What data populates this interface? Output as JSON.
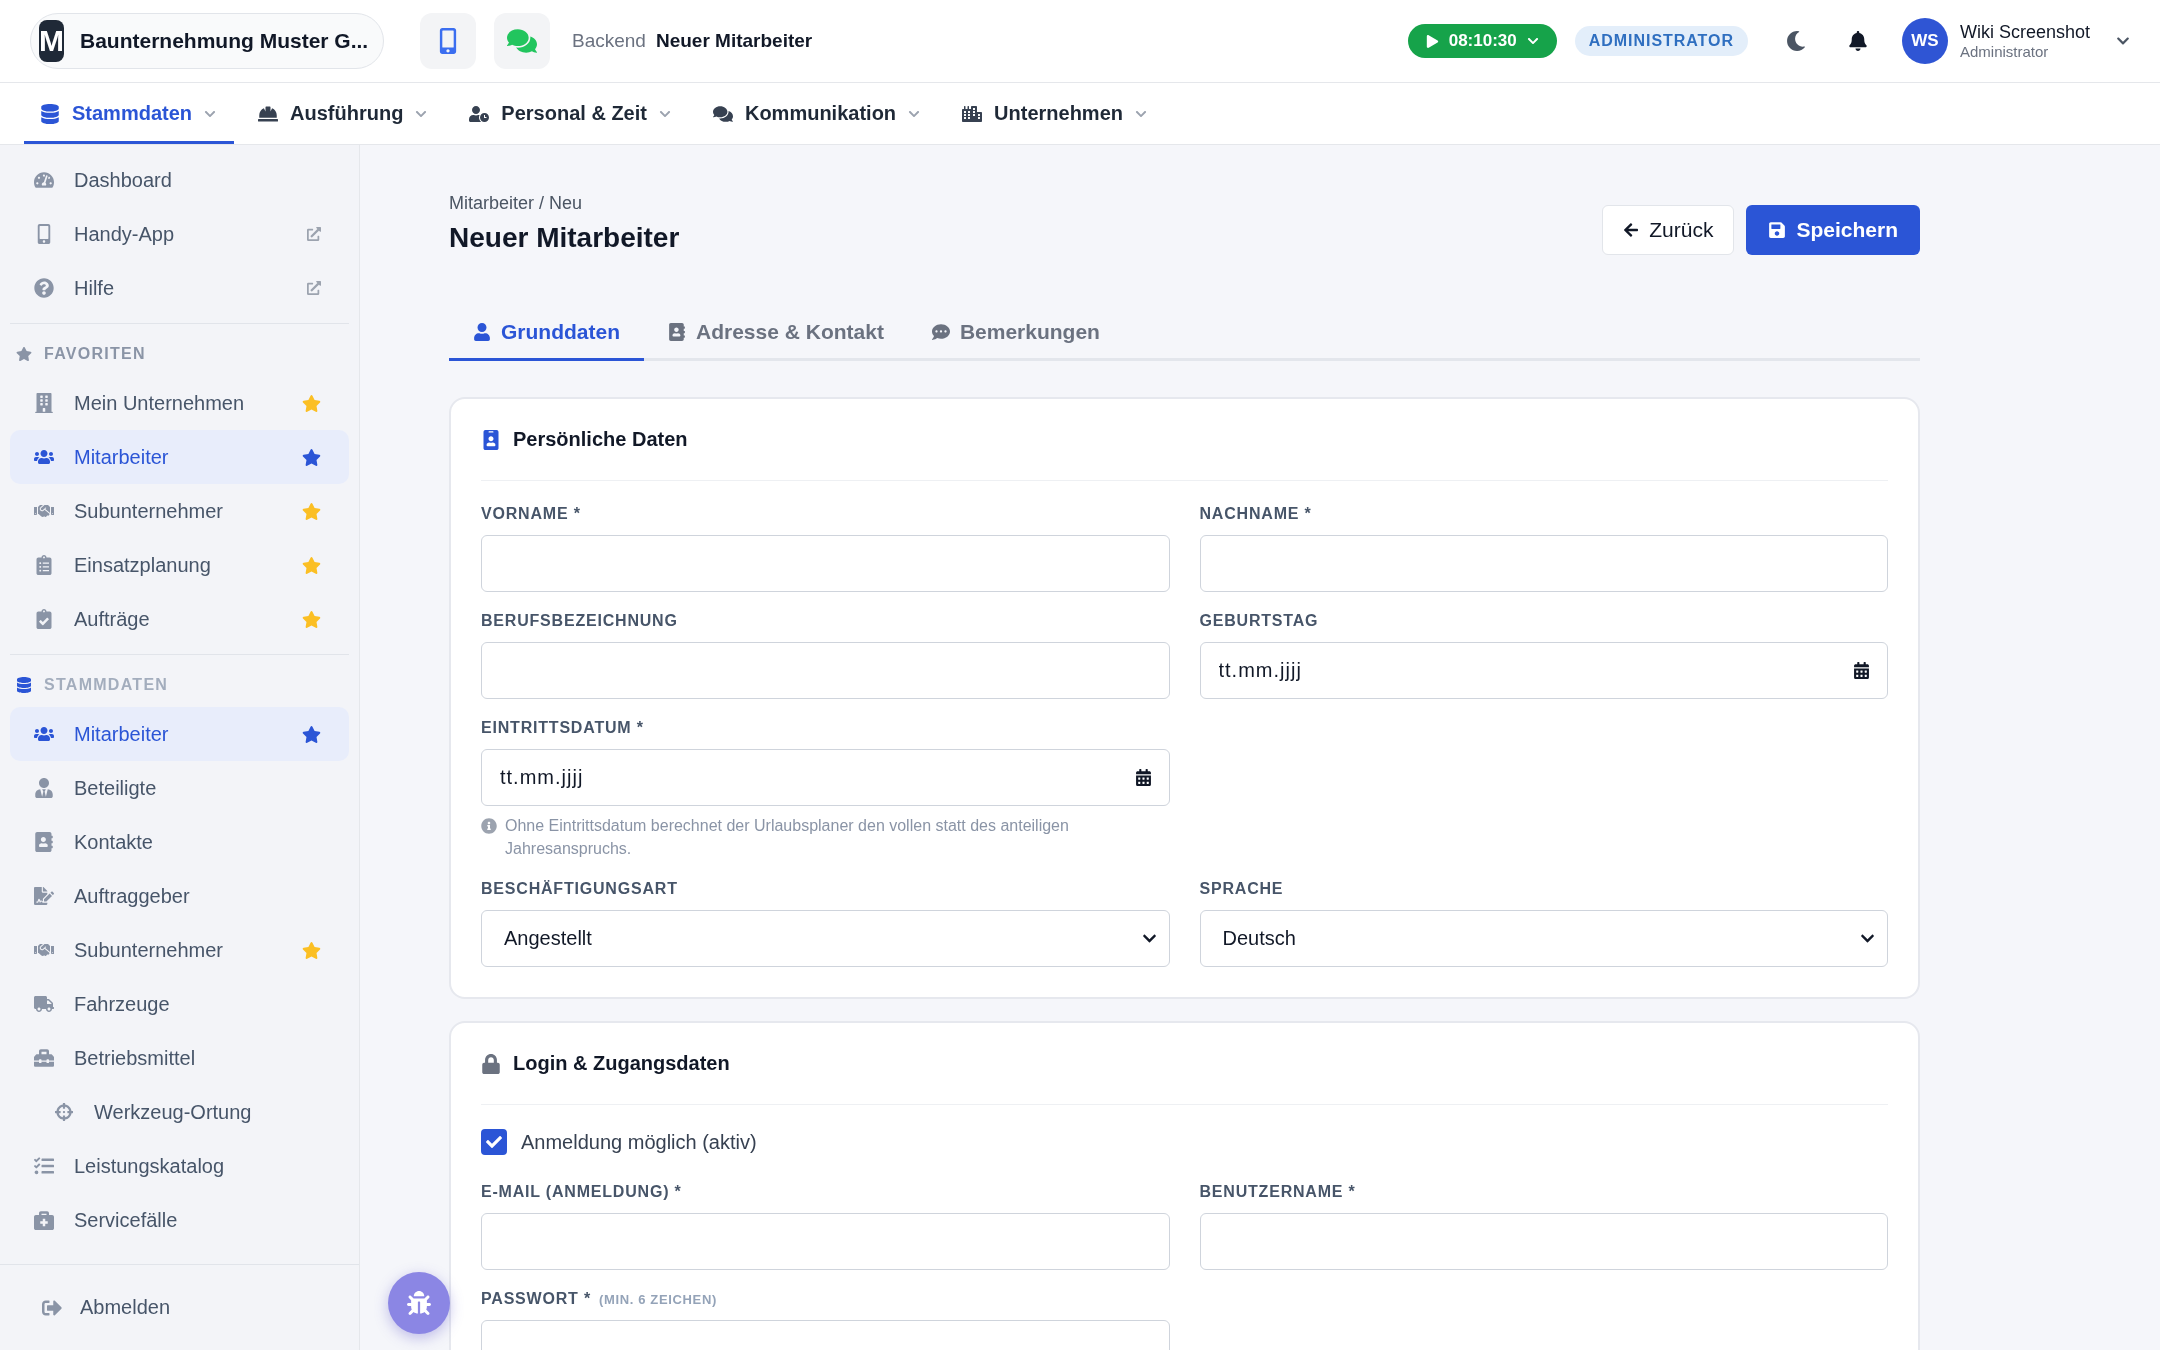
{
  "header": {
    "logo_letter": "M",
    "company": "Baunternehmung Muster G...",
    "breadcrumb_prefix": "Backend",
    "breadcrumb_current": "Neuer Mitarbeiter",
    "timer": "08:10:30",
    "role_badge": "ADMINISTRATOR",
    "user": {
      "initials": "WS",
      "name": "Wiki Screenshot",
      "role": "Administrator"
    }
  },
  "nav": [
    {
      "label": "Stammdaten",
      "selected": true
    },
    {
      "label": "Ausführung",
      "selected": false
    },
    {
      "label": "Personal & Zeit",
      "selected": false
    },
    {
      "label": "Kommunikation",
      "selected": false
    },
    {
      "label": "Unternehmen",
      "selected": false
    }
  ],
  "sidebar": {
    "top_items": [
      {
        "label": "Dashboard",
        "external": false
      },
      {
        "label": "Handy-App",
        "external": true
      },
      {
        "label": "Hilfe",
        "external": true
      }
    ],
    "sections": [
      {
        "title": "FAVORITEN",
        "items": [
          {
            "label": "Mein Unternehmen",
            "selected": false,
            "favorite": true
          },
          {
            "label": "Mitarbeiter",
            "selected": true,
            "favorite": true
          },
          {
            "label": "Subunternehmer",
            "selected": false,
            "favorite": true
          },
          {
            "label": "Einsatzplanung",
            "selected": false,
            "favorite": true
          },
          {
            "label": "Aufträge",
            "selected": false,
            "favorite": true
          }
        ]
      },
      {
        "title": "STAMMDATEN",
        "items": [
          {
            "label": "Mitarbeiter",
            "selected": true,
            "favorite": true
          },
          {
            "label": "Beteiligte",
            "selected": false,
            "favorite": false
          },
          {
            "label": "Kontakte",
            "selected": false,
            "favorite": false
          },
          {
            "label": "Auftraggeber",
            "selected": false,
            "favorite": false
          },
          {
            "label": "Subunternehmer",
            "selected": false,
            "favorite": true
          },
          {
            "label": "Fahrzeuge",
            "selected": false,
            "favorite": false
          },
          {
            "label": "Betriebsmittel",
            "selected": false,
            "favorite": false,
            "children": [
              {
                "label": "Werkzeug-Ortung",
                "selected": false,
                "favorite": false
              }
            ]
          },
          {
            "label": "Leistungskatalog",
            "selected": false,
            "favorite": false
          },
          {
            "label": "Servicefälle",
            "selected": false,
            "favorite": false
          }
        ]
      }
    ],
    "logout": "Abmelden"
  },
  "page": {
    "breadcrumb": "Mitarbeiter / Neu",
    "title": "Neuer Mitarbeiter",
    "back_button": "Zurück",
    "save_button": "Speichern"
  },
  "tabs": [
    {
      "label": "Grunddaten",
      "selected": true
    },
    {
      "label": "Adresse & Kontakt",
      "selected": false
    },
    {
      "label": "Bemerkungen",
      "selected": false
    }
  ],
  "cards": [
    {
      "title": "Persönliche Daten",
      "rows": [
        [
          {
            "kind": "text",
            "label": "VORNAME *"
          },
          {
            "kind": "text",
            "label": "NACHNAME *"
          }
        ],
        [
          {
            "kind": "text",
            "label": "BERUFSBEZEICHNUNG"
          },
          {
            "kind": "date",
            "label": "GEBURTSTAG",
            "placeholder": "tt.mm.jjjj"
          }
        ],
        [
          {
            "kind": "date",
            "label": "EINTRITTSDATUM *",
            "placeholder": "tt.mm.jjjj",
            "hint": "Ohne Eintrittsdatum berechnet der Urlaubsplaner den vollen statt des anteiligen Jahresanspruchs."
          }
        ],
        [
          {
            "kind": "select",
            "label": "BESCHÄFTIGUNGSART",
            "value": "Angestellt"
          },
          {
            "kind": "select",
            "label": "SPRACHE",
            "value": "Deutsch"
          }
        ]
      ]
    },
    {
      "title": "Login & Zugangsdaten",
      "rows": [
        [
          {
            "kind": "checkbox",
            "label": "Anmeldung möglich (aktiv)",
            "checked": true
          }
        ],
        [
          {
            "kind": "text",
            "label": "E-MAIL (ANMELDUNG) *"
          },
          {
            "kind": "text",
            "label": "BENUTZERNAME *"
          }
        ],
        [
          {
            "kind": "text",
            "label": "PASSWORT *",
            "note": "(MIN. 6 ZEICHEN)"
          }
        ]
      ]
    }
  ]
}
